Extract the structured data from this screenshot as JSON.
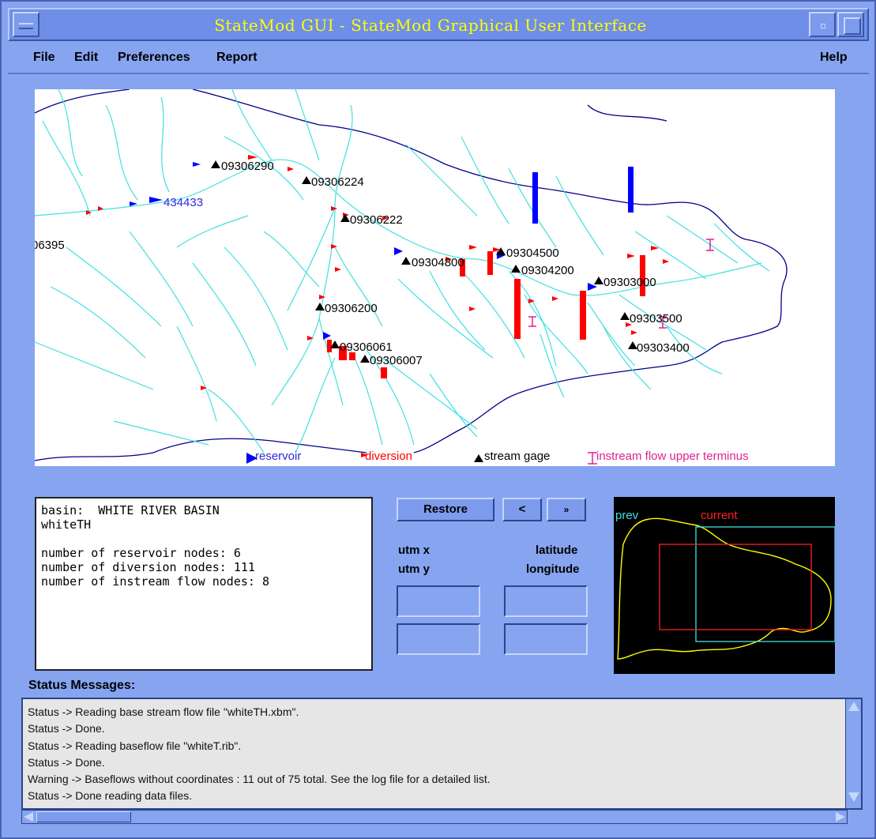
{
  "window": {
    "title": "StateMod GUI - StateMod Graphical User Interface"
  },
  "menu": {
    "file": "File",
    "edit": "Edit",
    "preferences": "Preferences",
    "report": "Report",
    "help": "Help"
  },
  "map": {
    "gage_labels": [
      "09306290",
      "09306224",
      "09306222",
      "09304800",
      "09304500",
      "09304200",
      "09303000",
      "09303400",
      "09303500",
      "09306200",
      "09306061",
      "09306007",
      "09303400"
    ],
    "reservoir_label": "434433",
    "left_label": "06395",
    "legend": {
      "reservoir": "reservoir",
      "diversion": "diversion",
      "stream_gage": "stream gage",
      "instream": "instream flow upper terminus"
    },
    "colors": {
      "stream": "#40e0e0",
      "boundary": "#00008b",
      "reservoir": "#0000ff",
      "diversion": "#ff0000",
      "instream": "#e0208f"
    }
  },
  "info": {
    "text": "basin:  WHITE RIVER BASIN\nwhiteTH\n\nnumber of reservoir nodes: 6\nnumber of diversion nodes: 111\nnumber of instream flow nodes: 8"
  },
  "controls": {
    "restore": "Restore",
    "prev": "<",
    "next": "»",
    "utm_x": "utm x",
    "utm_y": "utm y",
    "latitude": "latitude",
    "longitude": "longitude"
  },
  "overview": {
    "prev_label": "prev",
    "current_label": "current"
  },
  "status": {
    "title": "Status Messages:",
    "lines": [
      "Status  -> Reading base stream flow file \"whiteTH.xbm\".",
      "Status  -> Done.",
      "Status  -> Reading baseflow file \"whiteT.rib\".",
      "Status  -> Done.",
      "Warning -> Baseflows without coordinates : 11 out of 75 total.  See the log file for a detailed list.",
      "Status  -> Done reading data files."
    ]
  }
}
